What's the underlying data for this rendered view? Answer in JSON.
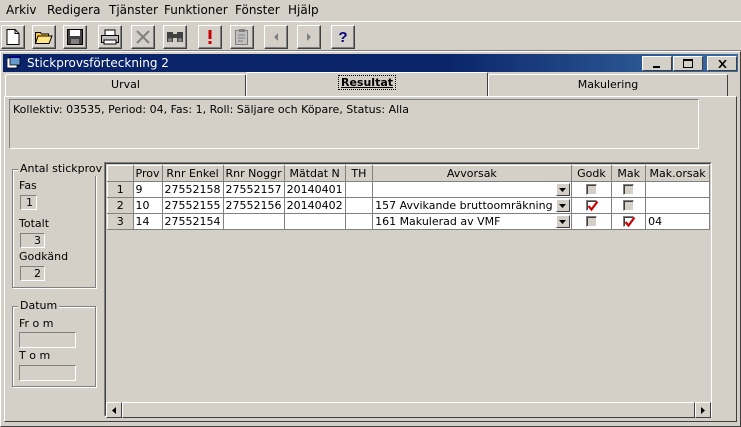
{
  "menu": {
    "items": [
      "Arkiv",
      "Redigera",
      "Tjänster",
      "Funktioner",
      "Fönster",
      "Hjälp"
    ]
  },
  "toolbar": {
    "buttons": [
      "new-document-icon",
      "open-folder-icon",
      "save-disk-icon",
      "print-icon",
      "delete-x-icon",
      "find-binoculars-icon",
      "exclamation-icon",
      "clipboard-icon",
      "previous-arrow-icon",
      "next-arrow-icon",
      "help-question-icon"
    ]
  },
  "window": {
    "title": "Stickprovsförteckning 2"
  },
  "tabs": {
    "urval": "Urval",
    "resultat": "Resultat",
    "makulering": "Makulering"
  },
  "info": {
    "text": "Kollektiv: 03535, Period: 04, Fas: 1, Roll: Säljare och Köpare, Status: Alla"
  },
  "antal": {
    "group_label": "Antal stickprov",
    "fas_label": "Fas",
    "fas_value": "1",
    "totalt_label": "Totalt",
    "totalt_value": "3",
    "godkand_label": "Godkänd",
    "godkand_value": "2"
  },
  "datum": {
    "group_label": "Datum",
    "from_label": "Fr o m",
    "tom_label": "T o m",
    "from_value": "",
    "tom_value": ""
  },
  "grid": {
    "headers": [
      "",
      "Prov",
      "Rnr Enkel",
      "Rnr Noggr",
      "Mätdat N",
      "TH",
      "Avvorsak",
      "Godk",
      "Mak",
      "Mak.orsak"
    ],
    "rows": [
      {
        "num": "1",
        "prov": "9",
        "rnr_enkel": "27552158",
        "rnr_noggr": "27552157",
        "matdat": "20140401",
        "th": "",
        "avvorsak": "",
        "godk": false,
        "mak": false,
        "makorsak": ""
      },
      {
        "num": "2",
        "prov": "10",
        "rnr_enkel": "27552155",
        "rnr_noggr": "27552156",
        "matdat": "20140402",
        "th": "",
        "avvorsak": "157 Avvikande bruttoomräkning",
        "godk": true,
        "mak": false,
        "makorsak": ""
      },
      {
        "num": "3",
        "prov": "14",
        "rnr_enkel": "27552154",
        "rnr_noggr": "",
        "matdat": "",
        "th": "",
        "avvorsak": "161 Makulerad av VMF",
        "godk": false,
        "mak": true,
        "makorsak": "04"
      }
    ]
  },
  "colors": {
    "titlebar": "#0a246a",
    "face": "#d4d0c8",
    "check": "#cc0000"
  }
}
